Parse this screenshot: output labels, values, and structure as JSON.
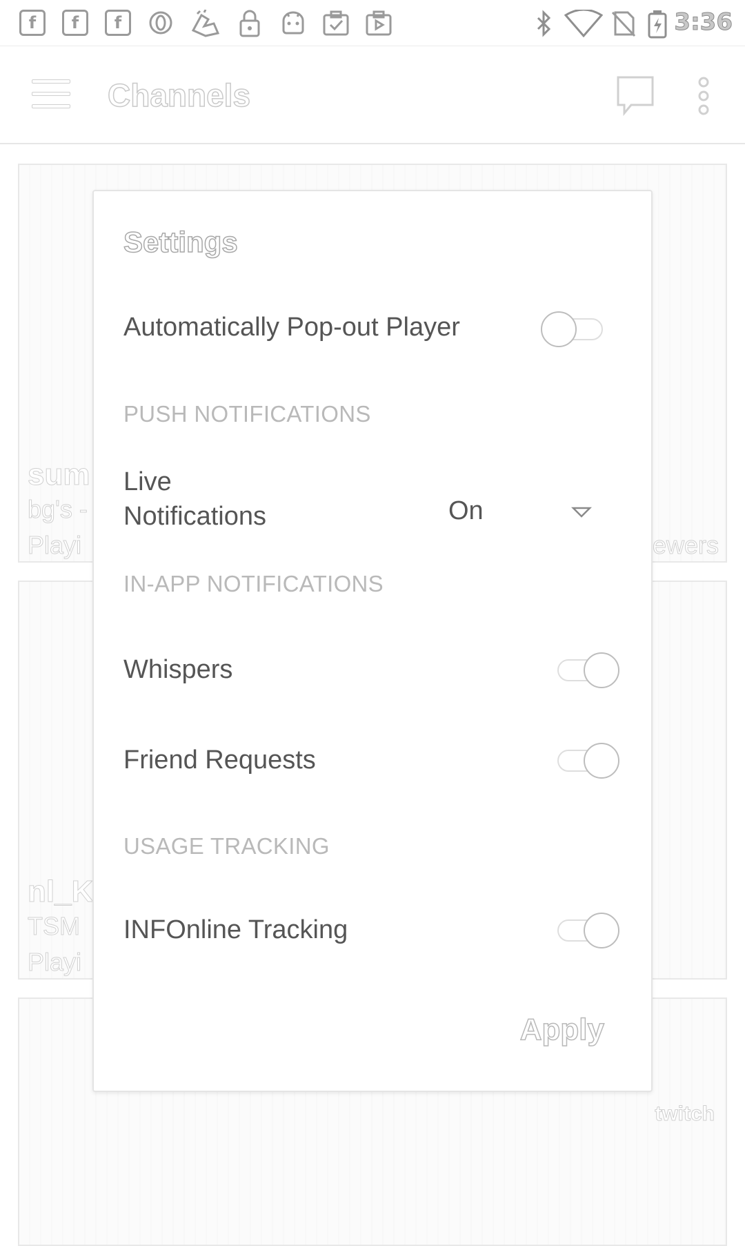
{
  "status_bar": {
    "notification_icons": [
      "facebook-icon",
      "facebook-icon",
      "facebook-icon",
      "opera-icon",
      "fandango-icon",
      "lock-icon",
      "android-icon",
      "clipboard-check-icon",
      "video-player-icon"
    ],
    "fb_glyph": "f",
    "system_icons": [
      "bluetooth-icon",
      "wifi-icon",
      "no-sim-icon",
      "battery-charging-icon"
    ],
    "time": "3:36"
  },
  "app_bar": {
    "title": "Channels",
    "icons": [
      "menu-icon",
      "chat-icon",
      "more-vert-icon"
    ]
  },
  "background_cards": [
    {
      "title": "sum",
      "subtitle": "bg's -",
      "status": "Playi",
      "viewers": "ewers"
    },
    {
      "title": "nl_K",
      "subtitle": "TSM",
      "status": "Playi"
    },
    {
      "brand": "twitch"
    }
  ],
  "dialog": {
    "title": "Settings",
    "popout_label": "Automatically Pop-out Player",
    "popout_enabled": false,
    "push_header": "PUSH NOTIFICATIONS",
    "live_label_line1": "Live",
    "live_label_line2": "Notifications",
    "live_value": "On",
    "inapp_header": "IN-APP NOTIFICATIONS",
    "whispers_label": "Whispers",
    "whispers_enabled": true,
    "friend_label": "Friend Requests",
    "friend_enabled": true,
    "usage_header": "USAGE TRACKING",
    "tracking_label": "INFOnline Tracking",
    "tracking_enabled": true,
    "apply_label": "Apply"
  }
}
